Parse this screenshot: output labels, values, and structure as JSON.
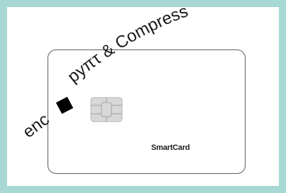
{
  "slogan": {
    "part1": "enc",
    "part2": "pyπτ & Compress",
    "censor_block": "black-square"
  },
  "card": {
    "label": "SmartCard",
    "chip_icon": "smartcard-chip-icon"
  },
  "colors": {
    "frame": "#a8d8d4",
    "card_border": "#5c5c5c",
    "chip": "#c9c9c9",
    "text": "#1a1a1a"
  }
}
